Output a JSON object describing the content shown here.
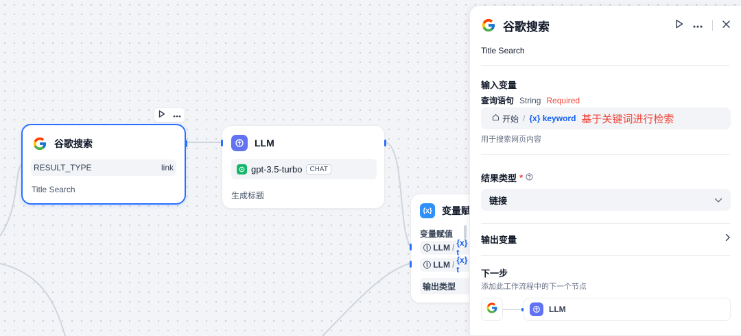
{
  "canvas": {
    "google_node": {
      "title": "谷歌搜索",
      "param_label": "RESULT_TYPE",
      "param_value": "link",
      "description": "Title Search"
    },
    "llm_node": {
      "title": "LLM",
      "model": "gpt-3.5-turbo",
      "mode": "CHAT",
      "description": "生成标题"
    },
    "assigner_node": {
      "title": "变量赋",
      "section_label": "变量赋值",
      "rows": [
        {
          "source": "LLM",
          "var": "{x} t"
        },
        {
          "source": "LLM",
          "var": "{x} t"
        }
      ],
      "output_type_label": "输出类型"
    }
  },
  "panel": {
    "title": "谷歌搜索",
    "description": "Title Search",
    "input_section_label": "输入变量",
    "param": {
      "name": "查询语句",
      "type": "String",
      "required": "Required"
    },
    "input_value": {
      "start_label": "开始",
      "var_label": "{x} keyword",
      "annotation": "基于关键词进行检索"
    },
    "input_hint": "用于搜索网页内容",
    "result_type_label": "结果类型",
    "required_mark": "*",
    "result_type_value": "链接",
    "output_section_label": "输出变量",
    "next_step_label": "下一步",
    "next_step_hint": "添加此工作流程中的下一个节点",
    "next_node_label": "LLM"
  },
  "colors": {
    "accent": "#2970ff",
    "llm_badge": "#6172f3",
    "var_badge": "#2e90fa",
    "required": "#f04438",
    "canvas_bg": "#f2f4f7"
  },
  "icons": [
    "google-icon",
    "play-icon",
    "more-icon",
    "close-icon",
    "llm-icon",
    "openai-icon",
    "variable-icon",
    "home-icon",
    "help-icon",
    "chevron-down-icon",
    "chevron-right-icon"
  ]
}
